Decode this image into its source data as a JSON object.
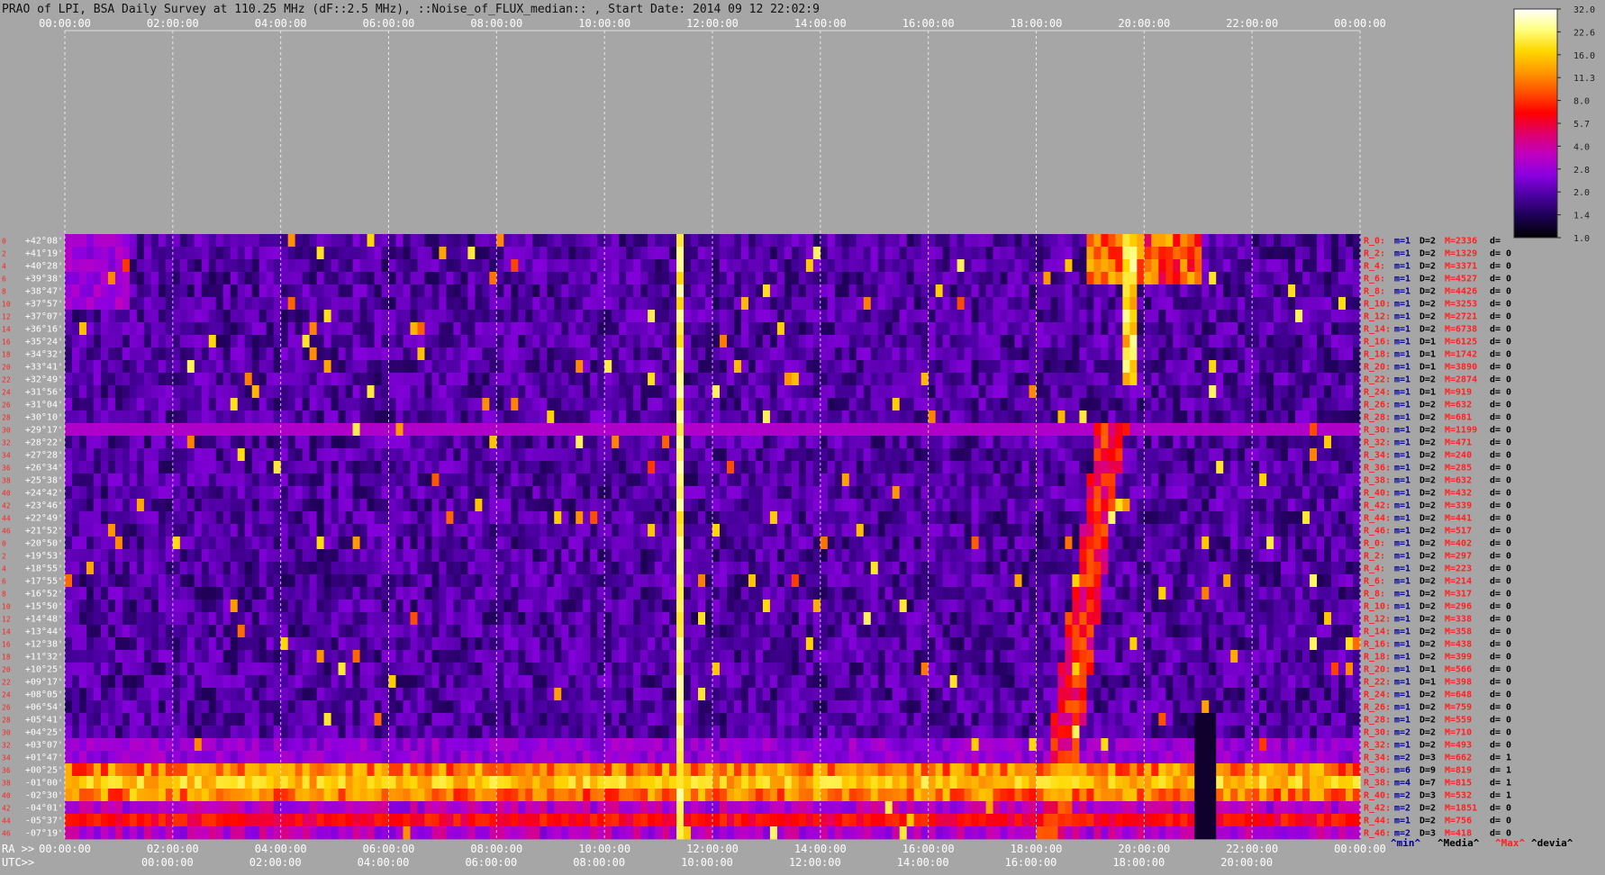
{
  "title": "PRAO of LPI, BSA Daily Survey at 110.25 MHz (dF::2.5 MHz), ::Noise_of_FLUX_median:: , Start Date: 2014 09 12 22:02:9",
  "chart_data": {
    "type": "heatmap",
    "title": "PRAO of LPI, BSA Daily Survey at 110.25 MHz (dF::2.5 MHz), ::Noise_of_FLUX_median:: , Start Date: 2014 09 12 22:02:9",
    "top_axis_labels": [
      "00:00:00",
      "02:00:00",
      "04:00:00",
      "06:00:00",
      "08:00:00",
      "10:00:00",
      "12:00:00",
      "14:00:00",
      "16:00:00",
      "18:00:00",
      "20:00:00",
      "22:00:00",
      "00:00:00"
    ],
    "ra_axis_prefix": "RA >>",
    "ra_axis_labels": [
      "00:00:00",
      "02:00:00",
      "04:00:00",
      "06:00:00",
      "08:00:00",
      "10:00:00",
      "12:00:00",
      "14:00:00",
      "16:00:00",
      "18:00:00",
      "20:00:00",
      "22:00:00",
      "00:00:00"
    ],
    "utc_axis_prefix": "UTC>>",
    "utc_axis_labels": [
      "00:00:00",
      "02:00:00",
      "04:00:00",
      "06:00:00",
      "08:00:00",
      "10:00:00",
      "12:00:00",
      "14:00:00",
      "16:00:00",
      "18:00:00",
      "20:00:00"
    ],
    "declinations": [
      "+42°08'",
      "+41°19'",
      "+40°28'",
      "+39°38'",
      "+38°47'",
      "+37°57'",
      "+37°07'",
      "+36°16'",
      "+35°24'",
      "+34°32'",
      "+33°41'",
      "+32°49'",
      "+31°56'",
      "+31°04'",
      "+30°10'",
      "+29°17'",
      "+28°22'",
      "+27°28'",
      "+26°34'",
      "+25°38'",
      "+24°42'",
      "+23°46'",
      "+22°49'",
      "+21°52'",
      "+20°50'",
      "+19°53'",
      "+18°55'",
      "+17°55'",
      "+16°52'",
      "+15°50'",
      "+14°48'",
      "+13°44'",
      "+12°38'",
      "+11°32'",
      "+10°25'",
      "+09°17'",
      "+08°05'",
      "+06°54'",
      "+05°41'",
      "+04°25'",
      "+03°07'",
      "+01°47'",
      "+00°25'",
      "-01°00'",
      "-02°30'",
      "-04°01'",
      "-05°37'",
      "-07°19'"
    ],
    "row_index_labels": [
      "0",
      "2",
      "4",
      "6",
      "8",
      "10",
      "12",
      "14",
      "16",
      "18",
      "20",
      "22",
      "24",
      "26",
      "28",
      "30",
      "32",
      "34",
      "36",
      "38",
      "40",
      "42",
      "44",
      "46",
      "0",
      "2",
      "4",
      "6",
      "8",
      "10",
      "12",
      "14",
      "16",
      "18",
      "20",
      "22",
      "24",
      "26",
      "28",
      "30",
      "32",
      "34",
      "36",
      "38",
      "40",
      "42",
      "44",
      "46"
    ],
    "row_stats": [
      {
        "r": "R_0:",
        "m": "m=1",
        "D": "D=2",
        "M": "M=2336",
        "d": "d="
      },
      {
        "r": "R_2:",
        "m": "m=1",
        "D": "D=2",
        "M": "M=1329",
        "d": "d= 0"
      },
      {
        "r": "R_4:",
        "m": "m=1",
        "D": "D=2",
        "M": "M=3371",
        "d": "d= 0"
      },
      {
        "r": "R_6:",
        "m": "m=1",
        "D": "D=2",
        "M": "M=4527",
        "d": "d= 0"
      },
      {
        "r": "R_8:",
        "m": "m=1",
        "D": "D=2",
        "M": "M=4426",
        "d": "d= 0"
      },
      {
        "r": "R_10:",
        "m": "m=1",
        "D": "D=2",
        "M": "M=3253",
        "d": "d= 0"
      },
      {
        "r": "R_12:",
        "m": "m=1",
        "D": "D=2",
        "M": "M=2721",
        "d": "d= 0"
      },
      {
        "r": "R_14:",
        "m": "m=1",
        "D": "D=2",
        "M": "M=6738",
        "d": "d= 0"
      },
      {
        "r": "R_16:",
        "m": "m=1",
        "D": "D=1",
        "M": "M=6125",
        "d": "d= 0"
      },
      {
        "r": "R_18:",
        "m": "m=1",
        "D": "D=1",
        "M": "M=1742",
        "d": "d= 0"
      },
      {
        "r": "R_20:",
        "m": "m=1",
        "D": "D=1",
        "M": "M=3890",
        "d": "d= 0"
      },
      {
        "r": "R_22:",
        "m": "m=1",
        "D": "D=2",
        "M": "M=2874",
        "d": "d= 0"
      },
      {
        "r": "R_24:",
        "m": "m=1",
        "D": "D=1",
        "M": "M=919",
        "d": "d= 0"
      },
      {
        "r": "R_26:",
        "m": "m=1",
        "D": "D=2",
        "M": "M=632",
        "d": "d= 0"
      },
      {
        "r": "R_28:",
        "m": "m=1",
        "D": "D=2",
        "M": "M=681",
        "d": "d= 0"
      },
      {
        "r": "R_30:",
        "m": "m=1",
        "D": "D=2",
        "M": "M=1199",
        "d": "d= 0"
      },
      {
        "r": "R_32:",
        "m": "m=1",
        "D": "D=2",
        "M": "M=471",
        "d": "d= 0"
      },
      {
        "r": "R_34:",
        "m": "m=1",
        "D": "D=2",
        "M": "M=240",
        "d": "d= 0"
      },
      {
        "r": "R_36:",
        "m": "m=1",
        "D": "D=2",
        "M": "M=285",
        "d": "d= 0"
      },
      {
        "r": "R_38:",
        "m": "m=1",
        "D": "D=2",
        "M": "M=632",
        "d": "d= 0"
      },
      {
        "r": "R_40:",
        "m": "m=1",
        "D": "D=2",
        "M": "M=432",
        "d": "d= 0"
      },
      {
        "r": "R_42:",
        "m": "m=1",
        "D": "D=2",
        "M": "M=339",
        "d": "d= 0"
      },
      {
        "r": "R_44:",
        "m": "m=1",
        "D": "D=2",
        "M": "M=441",
        "d": "d= 0"
      },
      {
        "r": "R_46:",
        "m": "m=1",
        "D": "D=2",
        "M": "M=517",
        "d": "d= 0"
      },
      {
        "r": "R_0:",
        "m": "m=1",
        "D": "D=2",
        "M": "M=402",
        "d": "d= 0"
      },
      {
        "r": "R_2:",
        "m": "m=1",
        "D": "D=2",
        "M": "M=297",
        "d": "d= 0"
      },
      {
        "r": "R_4:",
        "m": "m=1",
        "D": "D=2",
        "M": "M=223",
        "d": "d= 0"
      },
      {
        "r": "R_6:",
        "m": "m=1",
        "D": "D=2",
        "M": "M=214",
        "d": "d= 0"
      },
      {
        "r": "R_8:",
        "m": "m=1",
        "D": "D=2",
        "M": "M=317",
        "d": "d= 0"
      },
      {
        "r": "R_10:",
        "m": "m=1",
        "D": "D=2",
        "M": "M=296",
        "d": "d= 0"
      },
      {
        "r": "R_12:",
        "m": "m=1",
        "D": "D=2",
        "M": "M=338",
        "d": "d= 0"
      },
      {
        "r": "R_14:",
        "m": "m=1",
        "D": "D=2",
        "M": "M=358",
        "d": "d= 0"
      },
      {
        "r": "R_16:",
        "m": "m=1",
        "D": "D=2",
        "M": "M=438",
        "d": "d= 0"
      },
      {
        "r": "R_18:",
        "m": "m=1",
        "D": "D=2",
        "M": "M=399",
        "d": "d= 0"
      },
      {
        "r": "R_20:",
        "m": "m=1",
        "D": "D=1",
        "M": "M=566",
        "d": "d= 0"
      },
      {
        "r": "R_22:",
        "m": "m=1",
        "D": "D=1",
        "M": "M=398",
        "d": "d= 0"
      },
      {
        "r": "R_24:",
        "m": "m=1",
        "D": "D=2",
        "M": "M=648",
        "d": "d= 0"
      },
      {
        "r": "R_26:",
        "m": "m=1",
        "D": "D=2",
        "M": "M=759",
        "d": "d= 0"
      },
      {
        "r": "R_28:",
        "m": "m=1",
        "D": "D=2",
        "M": "M=559",
        "d": "d= 0"
      },
      {
        "r": "R_30:",
        "m": "m=2",
        "D": "D=2",
        "M": "M=710",
        "d": "d= 0"
      },
      {
        "r": "R_32:",
        "m": "m=1",
        "D": "D=2",
        "M": "M=493",
        "d": "d= 0"
      },
      {
        "r": "R_34:",
        "m": "m=2",
        "D": "D=3",
        "M": "M=662",
        "d": "d= 1"
      },
      {
        "r": "R_36:",
        "m": "m=6",
        "D": "D=9",
        "M": "M=819",
        "d": "d= 1"
      },
      {
        "r": "R_38:",
        "m": "m=4",
        "D": "D=7",
        "M": "M=815",
        "d": "d= 1"
      },
      {
        "r": "R_40:",
        "m": "m=2",
        "D": "D=3",
        "M": "M=532",
        "d": "d= 1"
      },
      {
        "r": "R_42:",
        "m": "m=2",
        "D": "D=2",
        "M": "M=1851",
        "d": "d= 0"
      },
      {
        "r": "R_44:",
        "m": "m=1",
        "D": "D=2",
        "M": "M=756",
        "d": "d= 0"
      },
      {
        "r": "R_46:",
        "m": "m=2",
        "D": "D=3",
        "M": "M=418",
        "d": "d= 0"
      }
    ],
    "stats_legend": [
      "^min^",
      "^Media^",
      "^Max^",
      "^devia^"
    ],
    "colorbar": {
      "ticks": [
        "32.0",
        "22.6",
        "16.0",
        "11.3",
        "8.0",
        "5.7",
        "4.0",
        "2.8",
        "2.0",
        "1.4",
        "1.0"
      ],
      "scale": "log",
      "range": [
        1.0,
        32.0
      ],
      "colors": [
        "#000000",
        "#1a0050",
        "#4a00a0",
        "#8a00e0",
        "#c000c0",
        "#e0006a",
        "#ff0000",
        "#ff5000",
        "#ff9a00",
        "#ffd800",
        "#ffff80",
        "#ffffff"
      ]
    },
    "grid": true
  },
  "colors": {
    "background": "#a6a6a6",
    "title": "#111111",
    "axis_label": "#ffffff",
    "dec_label": "#ffffff",
    "row_index": "#ff2020",
    "stat_r": "#ff2020",
    "stat_m": "#000090",
    "stat_D": "#000000",
    "stat_M": "#ff2020",
    "stat_d": "#000000",
    "legend_min": "#000090",
    "legend_media": "#000000",
    "legend_max": "#ff2020",
    "legend_devia": "#000000"
  }
}
